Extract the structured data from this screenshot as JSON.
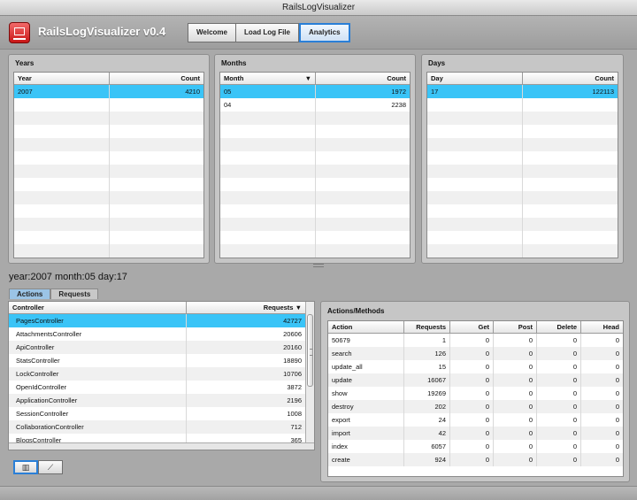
{
  "window": {
    "title": "RailsLogVisualizer"
  },
  "toolbar": {
    "app_title": "RailsLogVisualizer v0.4",
    "buttons": [
      {
        "label": "Welcome",
        "active": false
      },
      {
        "label": "Load Log File",
        "active": false
      },
      {
        "label": "Analytics",
        "active": true
      }
    ]
  },
  "years": {
    "title": "Years",
    "columns": [
      "Year",
      "Count"
    ],
    "rows": [
      {
        "year": "2007",
        "count": "4210",
        "selected": true
      }
    ]
  },
  "months": {
    "title": "Months",
    "columns": [
      "Month",
      "Count"
    ],
    "sort_indicator": "▼",
    "rows": [
      {
        "month": "05",
        "count": "1972",
        "selected": true
      },
      {
        "month": "04",
        "count": "2238",
        "selected": false
      }
    ]
  },
  "days": {
    "title": "Days",
    "columns": [
      "Day",
      "Count"
    ],
    "rows": [
      {
        "day": "17",
        "count": "122113",
        "selected": true
      }
    ]
  },
  "status": {
    "text": "year:2007 month:05 day:17"
  },
  "tabs": [
    {
      "label": "Actions",
      "active": true
    },
    {
      "label": "Requests",
      "active": false
    }
  ],
  "controllers": {
    "columns": [
      "Controller",
      "Requests"
    ],
    "sort_indicator": "▼",
    "rows": [
      {
        "name": "PagesController",
        "requests": "42727",
        "selected": true
      },
      {
        "name": "AttachmentsController",
        "requests": "20606"
      },
      {
        "name": "ApiController",
        "requests": "20160"
      },
      {
        "name": "StatsController",
        "requests": "18890"
      },
      {
        "name": "LockController",
        "requests": "10706"
      },
      {
        "name": "OpenIdController",
        "requests": "3872"
      },
      {
        "name": "ApplicationController",
        "requests": "2196"
      },
      {
        "name": "SessionController",
        "requests": "1008"
      },
      {
        "name": "CollaborationController",
        "requests": "712"
      },
      {
        "name": "BlogsController",
        "requests": "365"
      }
    ]
  },
  "view_buttons": [
    {
      "icon": "table-view-icon",
      "glyph": "▥",
      "active": true
    },
    {
      "icon": "chart-view-icon",
      "glyph": "⟋",
      "active": false
    }
  ],
  "actions": {
    "title": "Actions/Methods",
    "columns": [
      "Action",
      "Requests",
      "Get",
      "Post",
      "Delete",
      "Head"
    ],
    "rows": [
      [
        "50679",
        "1",
        "0",
        "0",
        "0",
        "0"
      ],
      [
        "search",
        "126",
        "0",
        "0",
        "0",
        "0"
      ],
      [
        "update_all",
        "15",
        "0",
        "0",
        "0",
        "0"
      ],
      [
        "update",
        "16067",
        "0",
        "0",
        "0",
        "0"
      ],
      [
        "show",
        "19269",
        "0",
        "0",
        "0",
        "0"
      ],
      [
        "destroy",
        "202",
        "0",
        "0",
        "0",
        "0"
      ],
      [
        "export",
        "24",
        "0",
        "0",
        "0",
        "0"
      ],
      [
        "import",
        "42",
        "0",
        "0",
        "0",
        "0"
      ],
      [
        "index",
        "6057",
        "0",
        "0",
        "0",
        "0"
      ],
      [
        "create",
        "924",
        "0",
        "0",
        "0",
        "0"
      ]
    ]
  }
}
